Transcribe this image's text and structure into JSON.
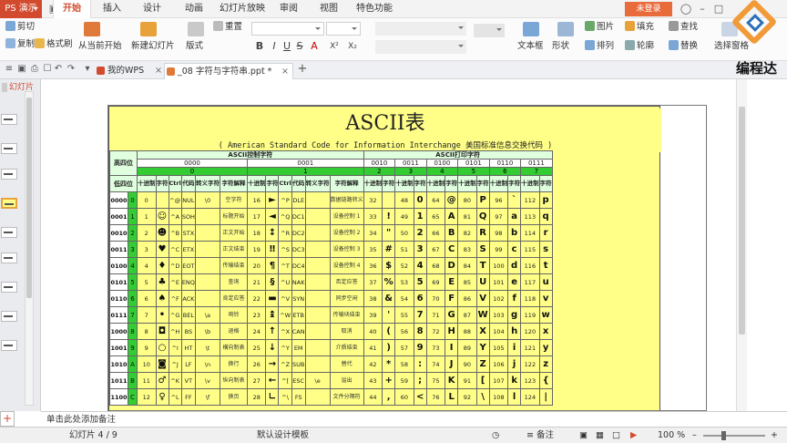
{
  "app": {
    "name": "PS 演示",
    "login": "未登录"
  },
  "menu_tabs": [
    "开始",
    "插入",
    "设计",
    "动画",
    "幻灯片放映",
    "审阅",
    "视图",
    "特色功能"
  ],
  "ribbon": {
    "clipboard": {
      "cut": "剪切",
      "copy": "复制",
      "format_painter": "格式刷",
      "paste_icon": "paste-icon"
    },
    "slides": {
      "from_current": "从当前开始",
      "new_slide": "新建幻灯片",
      "layout": "版式",
      "reset": "重置"
    },
    "font_buttons": [
      "B",
      "I",
      "U",
      "S",
      "A",
      "X²",
      "X₂"
    ],
    "draw": {
      "textbox": "文本框",
      "shape": "形状",
      "picture": "图片",
      "fill": "填充",
      "arrange": "排列",
      "outline": "轮廓"
    },
    "edit": {
      "find": "查找",
      "replace": "替换",
      "select_pane": "选择窗格"
    }
  },
  "tabs_bar": {
    "home": "我的WPS",
    "document": "_08 字符与字符串.ppt *",
    "add": "+"
  },
  "sidebar": {
    "tab": "幻灯片",
    "add": "+"
  },
  "slide": {
    "title": "ASCII表",
    "subtitle": "( American Standard Code for Information Interchange  美国标准信息交换代码 )",
    "corner_high": "高四位",
    "corner_low": "低四位",
    "group_ctrl": "ASCII控制字符",
    "group_print": "ASCII打印字符",
    "high_bits": [
      "0000",
      "0001",
      "0010",
      "0011",
      "0100",
      "0101",
      "0110",
      "0111"
    ],
    "high_index": [
      "0",
      "1",
      "2",
      "3",
      "4",
      "5",
      "6",
      "7"
    ],
    "ctrl_headers": [
      "十进制",
      "字符",
      "Ctrl",
      "代码",
      "转义字符",
      "字符解释"
    ],
    "print_headers": [
      "十进制",
      "字符"
    ],
    "rows": [
      {
        "low": "0000",
        "idx": "0",
        "c0": [
          "0",
          "",
          "^@",
          "NUL",
          "\\0",
          "空字符"
        ],
        "c1": [
          "16",
          "►",
          "^P",
          "DLE",
          "",
          "数据链路转义"
        ],
        "p": [
          [
            "32",
            ""
          ],
          [
            "48",
            "0"
          ],
          [
            "64",
            "@"
          ],
          [
            "80",
            "P"
          ],
          [
            "96",
            "`"
          ],
          [
            "112",
            "p"
          ]
        ]
      },
      {
        "low": "0001",
        "idx": "1",
        "c0": [
          "1",
          "☺",
          "^A",
          "SOH",
          "",
          "标题开始"
        ],
        "c1": [
          "17",
          "◄",
          "^Q",
          "DC1",
          "",
          "设备控制 1"
        ],
        "p": [
          [
            "33",
            "!"
          ],
          [
            "49",
            "1"
          ],
          [
            "65",
            "A"
          ],
          [
            "81",
            "Q"
          ],
          [
            "97",
            "a"
          ],
          [
            "113",
            "q"
          ]
        ]
      },
      {
        "low": "0010",
        "idx": "2",
        "c0": [
          "2",
          "☻",
          "^B",
          "STX",
          "",
          "正文开始"
        ],
        "c1": [
          "18",
          "↕",
          "^R",
          "DC2",
          "",
          "设备控制 2"
        ],
        "p": [
          [
            "34",
            "\""
          ],
          [
            "50",
            "2"
          ],
          [
            "66",
            "B"
          ],
          [
            "82",
            "R"
          ],
          [
            "98",
            "b"
          ],
          [
            "114",
            "r"
          ]
        ]
      },
      {
        "low": "0011",
        "idx": "3",
        "c0": [
          "3",
          "♥",
          "^C",
          "ETX",
          "",
          "正文结束"
        ],
        "c1": [
          "19",
          "‼",
          "^S",
          "DC3",
          "",
          "设备控制 3"
        ],
        "p": [
          [
            "35",
            "#"
          ],
          [
            "51",
            "3"
          ],
          [
            "67",
            "C"
          ],
          [
            "83",
            "S"
          ],
          [
            "99",
            "c"
          ],
          [
            "115",
            "s"
          ]
        ]
      },
      {
        "low": "0100",
        "idx": "4",
        "c0": [
          "4",
          "♦",
          "^D",
          "EOT",
          "",
          "传输结束"
        ],
        "c1": [
          "20",
          "¶",
          "^T",
          "DC4",
          "",
          "设备控制 4"
        ],
        "p": [
          [
            "36",
            "$"
          ],
          [
            "52",
            "4"
          ],
          [
            "68",
            "D"
          ],
          [
            "84",
            "T"
          ],
          [
            "100",
            "d"
          ],
          [
            "116",
            "t"
          ]
        ]
      },
      {
        "low": "0101",
        "idx": "5",
        "c0": [
          "5",
          "♣",
          "^E",
          "ENQ",
          "",
          "查询"
        ],
        "c1": [
          "21",
          "§",
          "^U",
          "NAK",
          "",
          "否定应答"
        ],
        "p": [
          [
            "37",
            "%"
          ],
          [
            "53",
            "5"
          ],
          [
            "69",
            "E"
          ],
          [
            "85",
            "U"
          ],
          [
            "101",
            "e"
          ],
          [
            "117",
            "u"
          ]
        ]
      },
      {
        "low": "0110",
        "idx": "6",
        "c0": [
          "6",
          "♠",
          "^F",
          "ACK",
          "",
          "肯定应答"
        ],
        "c1": [
          "22",
          "▬",
          "^V",
          "SYN",
          "",
          "同步空闲"
        ],
        "p": [
          [
            "38",
            "&"
          ],
          [
            "54",
            "6"
          ],
          [
            "70",
            "F"
          ],
          [
            "86",
            "V"
          ],
          [
            "102",
            "f"
          ],
          [
            "118",
            "v"
          ]
        ]
      },
      {
        "low": "0111",
        "idx": "7",
        "c0": [
          "7",
          "•",
          "^G",
          "BEL",
          "\\a",
          "响铃"
        ],
        "c1": [
          "23",
          "↨",
          "^W",
          "ETB",
          "",
          "传输块结束"
        ],
        "p": [
          [
            "39",
            "'"
          ],
          [
            "55",
            "7"
          ],
          [
            "71",
            "G"
          ],
          [
            "87",
            "W"
          ],
          [
            "103",
            "g"
          ],
          [
            "119",
            "w"
          ]
        ]
      },
      {
        "low": "1000",
        "idx": "8",
        "c0": [
          "8",
          "◘",
          "^H",
          "BS",
          "\\b",
          "退格"
        ],
        "c1": [
          "24",
          "↑",
          "^X",
          "CAN",
          "",
          "取消"
        ],
        "p": [
          [
            "40",
            "("
          ],
          [
            "56",
            "8"
          ],
          [
            "72",
            "H"
          ],
          [
            "88",
            "X"
          ],
          [
            "104",
            "h"
          ],
          [
            "120",
            "x"
          ]
        ]
      },
      {
        "low": "1001",
        "idx": "9",
        "c0": [
          "9",
          "○",
          "^I",
          "HT",
          "\\t",
          "横向制表"
        ],
        "c1": [
          "25",
          "↓",
          "^Y",
          "EM",
          "",
          "介质结束"
        ],
        "p": [
          [
            "41",
            ")"
          ],
          [
            "57",
            "9"
          ],
          [
            "73",
            "I"
          ],
          [
            "89",
            "Y"
          ],
          [
            "105",
            "i"
          ],
          [
            "121",
            "y"
          ]
        ]
      },
      {
        "low": "1010",
        "idx": "A",
        "c0": [
          "10",
          "◙",
          "^J",
          "LF",
          "\\n",
          "换行"
        ],
        "c1": [
          "26",
          "→",
          "^Z",
          "SUB",
          "",
          "替代"
        ],
        "p": [
          [
            "42",
            "*"
          ],
          [
            "58",
            ":"
          ],
          [
            "74",
            "J"
          ],
          [
            "90",
            "Z"
          ],
          [
            "106",
            "j"
          ],
          [
            "122",
            "z"
          ]
        ]
      },
      {
        "low": "1011",
        "idx": "B",
        "c0": [
          "11",
          "♂",
          "^K",
          "VT",
          "\\v",
          "纵向制表"
        ],
        "c1": [
          "27",
          "←",
          "^[",
          "ESC",
          "\\e",
          "溢出"
        ],
        "p": [
          [
            "43",
            "+"
          ],
          [
            "59",
            ";"
          ],
          [
            "75",
            "K"
          ],
          [
            "91",
            "["
          ],
          [
            "107",
            "k"
          ],
          [
            "123",
            "{"
          ]
        ]
      },
      {
        "low": "1100",
        "idx": "C",
        "c0": [
          "12",
          "♀",
          "^L",
          "FF",
          "\\f",
          "换页"
        ],
        "c1": [
          "28",
          "∟",
          "^\\",
          "FS",
          "",
          "文件分隔符"
        ],
        "p": [
          [
            "44",
            ","
          ],
          [
            "60",
            "<"
          ],
          [
            "76",
            "L"
          ],
          [
            "92",
            "\\"
          ],
          [
            "108",
            "l"
          ],
          [
            "124",
            "|"
          ]
        ]
      }
    ]
  },
  "notes": "单击此处添加备注",
  "status": {
    "slide_count": "幻灯片 4 / 9",
    "template": "默认设计模板",
    "notes_btn": "备注",
    "zoom": "100 %"
  },
  "logo_text": "编程达"
}
